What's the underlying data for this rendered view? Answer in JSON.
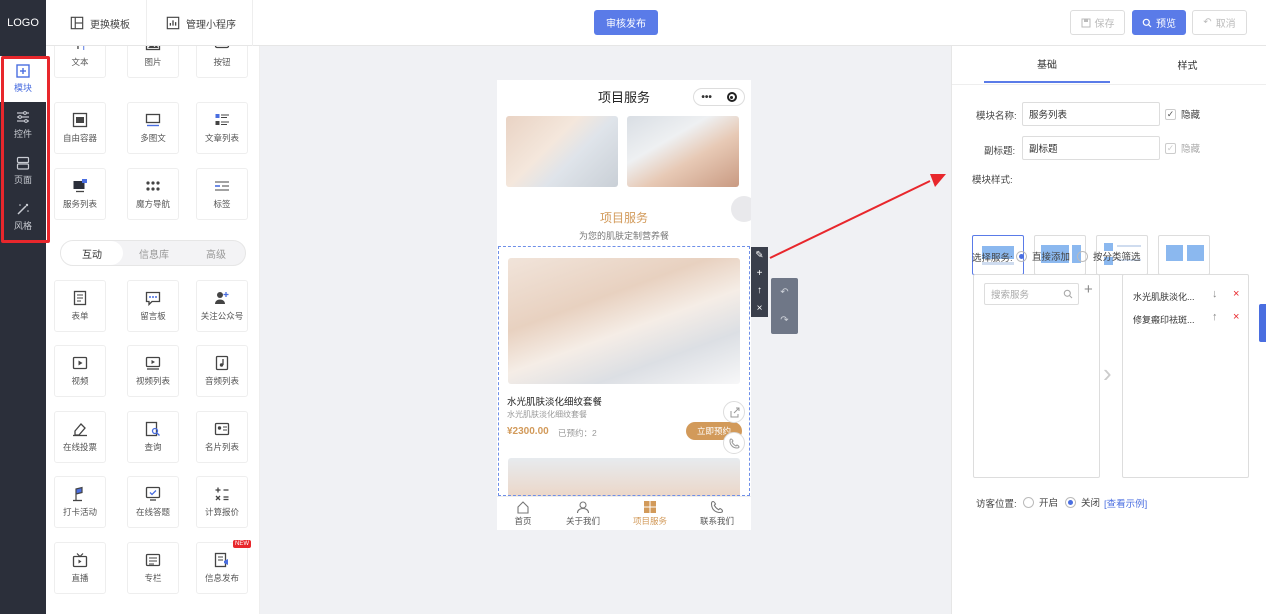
{
  "header": {
    "logo": "LOGO",
    "change_template": "更换模板",
    "manage_app": "管理小程序",
    "publish": "审核发布",
    "save": "保存",
    "preview": "预览",
    "cancel": "取消"
  },
  "rail": [
    {
      "label": "模块",
      "icon": "plus-square-icon"
    },
    {
      "label": "控件",
      "icon": "sliders-icon"
    },
    {
      "label": "页面",
      "icon": "pages-icon"
    },
    {
      "label": "风格",
      "icon": "magic-wand-icon"
    }
  ],
  "palette": {
    "basic": [
      {
        "label": "文本",
        "icon": "text-icon"
      },
      {
        "label": "图片",
        "icon": "image-icon"
      },
      {
        "label": "按钮",
        "icon": "button-icon"
      },
      {
        "label": "自由容器",
        "icon": "container-icon"
      },
      {
        "label": "多图文",
        "icon": "multi-image-text-icon"
      },
      {
        "label": "文章列表",
        "icon": "article-list-icon"
      },
      {
        "label": "服务列表",
        "icon": "service-list-icon"
      },
      {
        "label": "魔方导航",
        "icon": "cube-nav-icon"
      },
      {
        "label": "标签",
        "icon": "tag-icon"
      }
    ],
    "tabs": [
      "互动",
      "信息库",
      "高级"
    ],
    "interactive": [
      {
        "label": "表单",
        "icon": "form-icon"
      },
      {
        "label": "留言板",
        "icon": "message-board-icon"
      },
      {
        "label": "关注公众号",
        "icon": "follow-icon"
      },
      {
        "label": "视频",
        "icon": "video-icon"
      },
      {
        "label": "视频列表",
        "icon": "video-list-icon"
      },
      {
        "label": "音频列表",
        "icon": "audio-list-icon"
      },
      {
        "label": "在线投票",
        "icon": "vote-icon"
      },
      {
        "label": "查询",
        "icon": "query-icon"
      },
      {
        "label": "名片列表",
        "icon": "card-list-icon"
      },
      {
        "label": "打卡活动",
        "icon": "checkin-icon"
      },
      {
        "label": "在线答题",
        "icon": "quiz-icon"
      },
      {
        "label": "计算报价",
        "icon": "calculator-icon"
      },
      {
        "label": "直播",
        "icon": "live-icon"
      },
      {
        "label": "专栏",
        "icon": "column-icon"
      },
      {
        "label": "信息发布",
        "icon": "info-publish-icon"
      }
    ],
    "new_badge": "NEW"
  },
  "phone": {
    "title": "项目服务",
    "capsule_more": "•••",
    "section_title": "项目服务",
    "section_subtitle": "为您的肌肤定制营养餐",
    "product_name": "水光肌肤淡化细纹套餐",
    "product_desc": "水光肌肤淡化细纹套餐",
    "product_price": "¥2300.00",
    "product_booked": "已预约：2",
    "book_button": "立即预约",
    "tabs": [
      {
        "label": "首页",
        "icon": "home-icon"
      },
      {
        "label": "关于我们",
        "icon": "user-icon"
      },
      {
        "label": "项目服务",
        "icon": "grid-icon"
      },
      {
        "label": "联系我们",
        "icon": "phone-icon"
      }
    ]
  },
  "settings": {
    "tab_basic": "基础",
    "tab_style": "样式",
    "module_name_label": "模块名称:",
    "module_name_value": "服务列表",
    "hide_label_1": "隐藏",
    "subtitle_label": "副标题:",
    "subtitle_value": "副标题",
    "hide_label_2": "隐藏",
    "module_style_label": "模块样式:",
    "select_service_label": "选择服务:",
    "option_direct": "直接添加",
    "option_by_category": "按分类筛选",
    "search_placeholder": "搜索服务",
    "selected_services": [
      "水光肌肤淡化...",
      "修复瘢印祛斑..."
    ],
    "visitor_position_label": "访客位置:",
    "option_on": "开启",
    "option_off": "关闭",
    "view_example": "[查看示例]"
  },
  "colors": {
    "accent": "#5a7be8",
    "brand_gold": "#d29a5a",
    "highlight_red": "#e8272c",
    "rail_bg": "#2b2f3a"
  }
}
